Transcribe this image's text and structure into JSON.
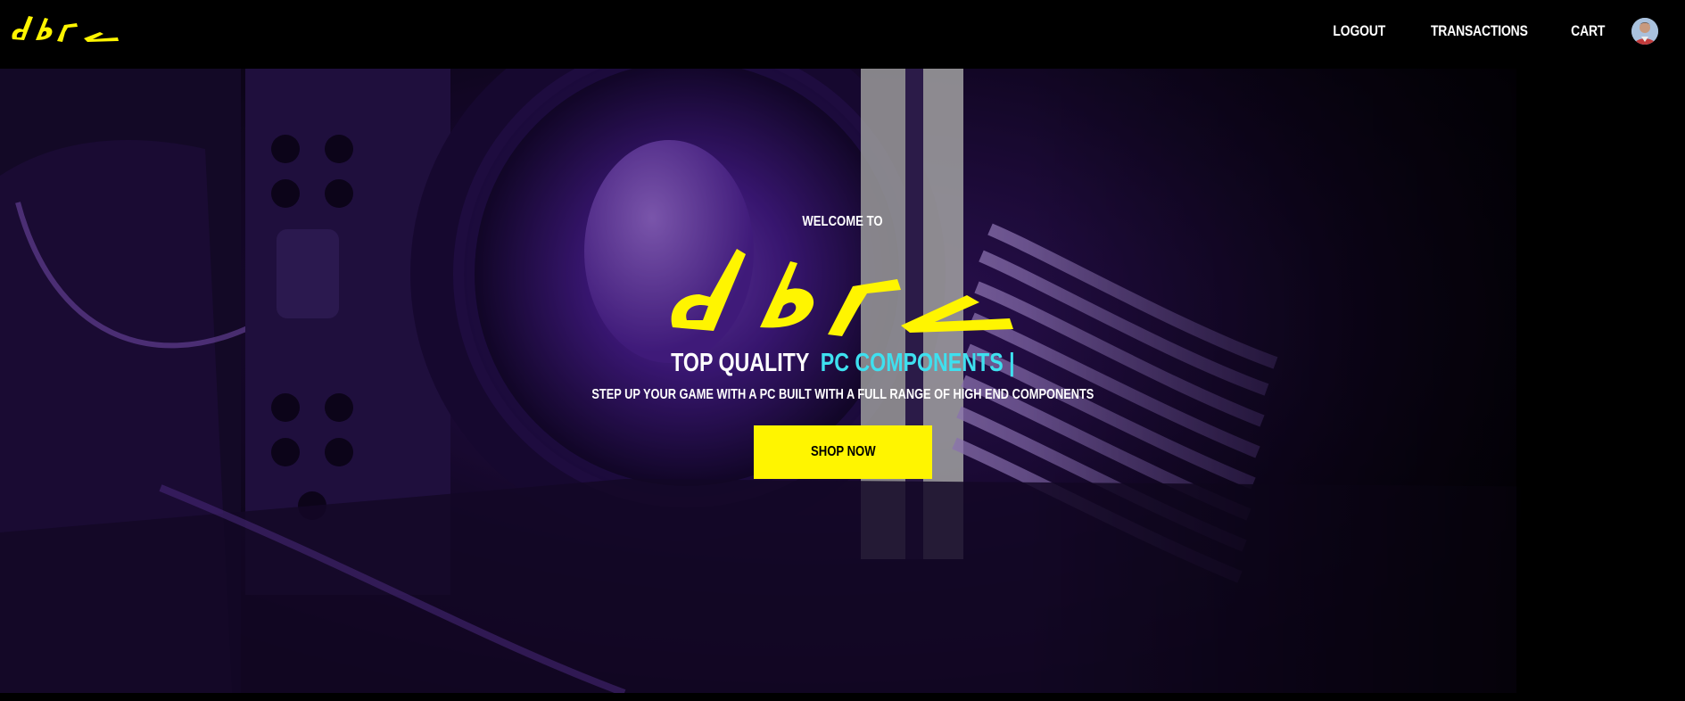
{
  "brand": {
    "logo_text": "dbpc",
    "accent_color": "#fff500"
  },
  "nav": {
    "items": [
      {
        "label": "LOGOUT"
      },
      {
        "label": "TRANSACTIONS"
      },
      {
        "label": "CART"
      }
    ],
    "avatar_icon": "user-avatar"
  },
  "hero": {
    "welcome": "WELCOME TO",
    "tagline_prefix": "TOP QUALITY",
    "tagline_highlight": "PC COMPONENTS",
    "tagline_cursor": "|",
    "subtitle": "STEP UP YOUR GAME WITH A PC BUILT WITH A FULL RANGE OF HIGH END COMPONENTS",
    "cta_label": "SHOP NOW",
    "highlight_color": "#3ee0ef"
  }
}
